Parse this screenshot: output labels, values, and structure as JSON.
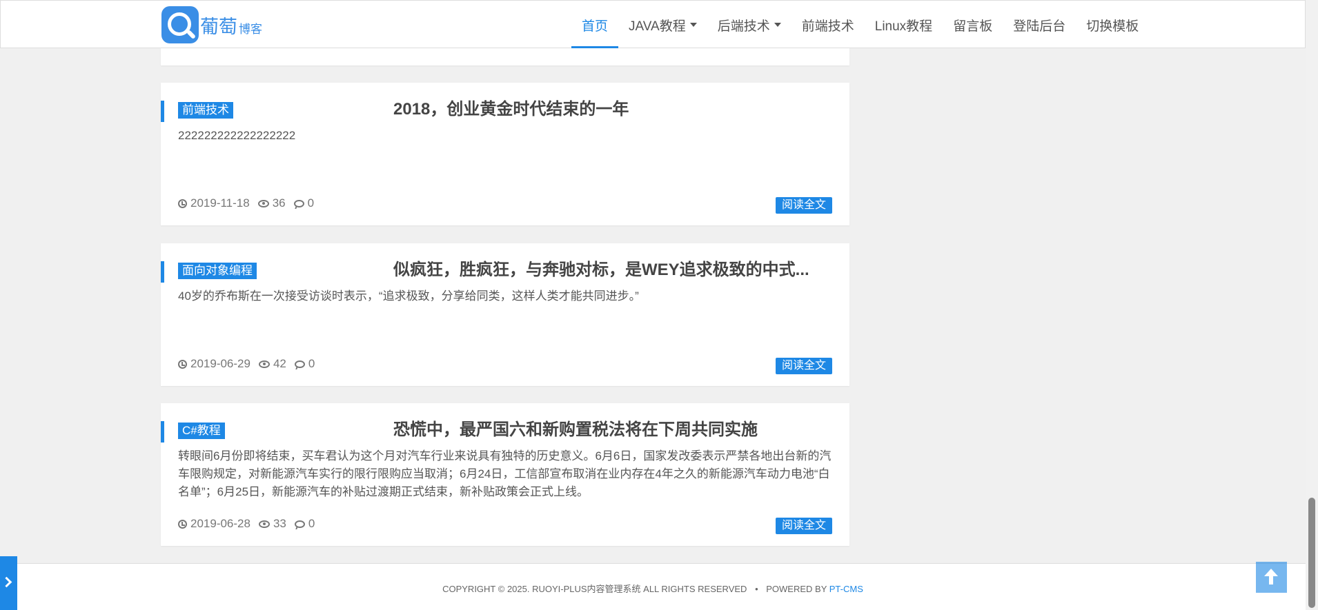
{
  "header": {
    "logo": {
      "main": "葡萄",
      "sub": "博客"
    },
    "nav": [
      {
        "label": "首页",
        "active": true,
        "dropdown": false
      },
      {
        "label": "JAVA教程",
        "active": false,
        "dropdown": true
      },
      {
        "label": "后端技术",
        "active": false,
        "dropdown": true
      },
      {
        "label": "前端技术",
        "active": false,
        "dropdown": false
      },
      {
        "label": "Linux教程",
        "active": false,
        "dropdown": false
      },
      {
        "label": "留言板",
        "active": false,
        "dropdown": false
      },
      {
        "label": "登陆后台",
        "active": false,
        "dropdown": false
      },
      {
        "label": "切换模板",
        "active": false,
        "dropdown": false
      }
    ]
  },
  "posts": [
    {
      "category": "前端技术",
      "title": "2018，创业黄金时代结束的一年",
      "summary": "222222222222222222",
      "date": "2019-11-18",
      "views": "36",
      "comments": "0",
      "read_label": "阅读全文"
    },
    {
      "category": "面向对象编程",
      "title": "似疯狂，胜疯狂，与奔驰对标，是WEY追求极致的中式...",
      "summary": "40岁的乔布斯在一次接受访谈时表示，“追求极致，分享给同类，这样人类才能共同进步。”",
      "date": "2019-06-29",
      "views": "42",
      "comments": "0",
      "read_label": "阅读全文"
    },
    {
      "category": "C#教程",
      "title": "恐慌中，最严国六和新购置税法将在下周共同实施",
      "summary": "转眼间6月份即将结束，买车君认为这个月对汽车行业来说具有独特的历史意义。6月6日，国家发改委表示严禁各地出台新的汽车限购规定，对新能源汽车实行的限行限购应当取消；6月24日，工信部宣布取消在业内存在4年之久的新能源汽车动力电池“白名单”；6月25日，新能源汽车的补贴过渡期正式结束，新补贴政策会正式上线。",
      "date": "2019-06-28",
      "views": "33",
      "comments": "0",
      "read_label": "阅读全文"
    }
  ],
  "footer": {
    "copyright": "COPYRIGHT © 2025. RUOYI-PLUS内容管理系统 ALL RIGHTS RESERVED",
    "separator": "•",
    "powered_prefix": "POWERED BY",
    "powered_link": "PT-CMS"
  },
  "colors": {
    "accent": "#1e88e5",
    "background": "#f0f0f0"
  }
}
